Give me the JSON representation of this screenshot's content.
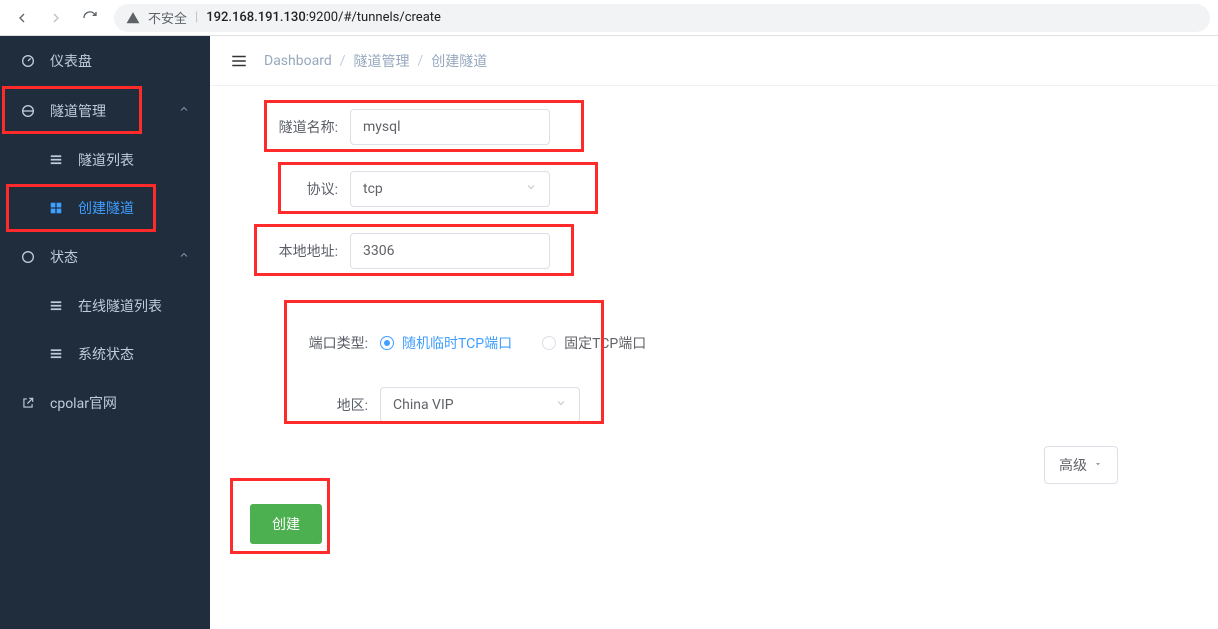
{
  "browser": {
    "insecure_label": "不安全",
    "url_ip": "192.168.191.130",
    "url_rest": ":9200/#/tunnels/create"
  },
  "sidebar": {
    "dashboard": "仪表盘",
    "tunnel_mgmt": "隧道管理",
    "tunnel_list": "隧道列表",
    "create_tunnel": "创建隧道",
    "status": "状态",
    "online_tunnels": "在线隧道列表",
    "system_status": "系统状态",
    "cpolar_site": "cpolar官网"
  },
  "breadcrumb": {
    "a": "Dashboard",
    "b": "隧道管理",
    "c": "创建隧道"
  },
  "form": {
    "name_label": "隧道名称:",
    "name_value": "mysql",
    "proto_label": "协议:",
    "proto_value": "tcp",
    "local_label": "本地地址:",
    "local_value": "3306",
    "port_type_label": "端口类型:",
    "port_type_random": "随机临时TCP端口",
    "port_type_fixed": "固定TCP端口",
    "region_label": "地区:",
    "region_value": "China VIP",
    "advanced": "高级",
    "create": "创建"
  }
}
